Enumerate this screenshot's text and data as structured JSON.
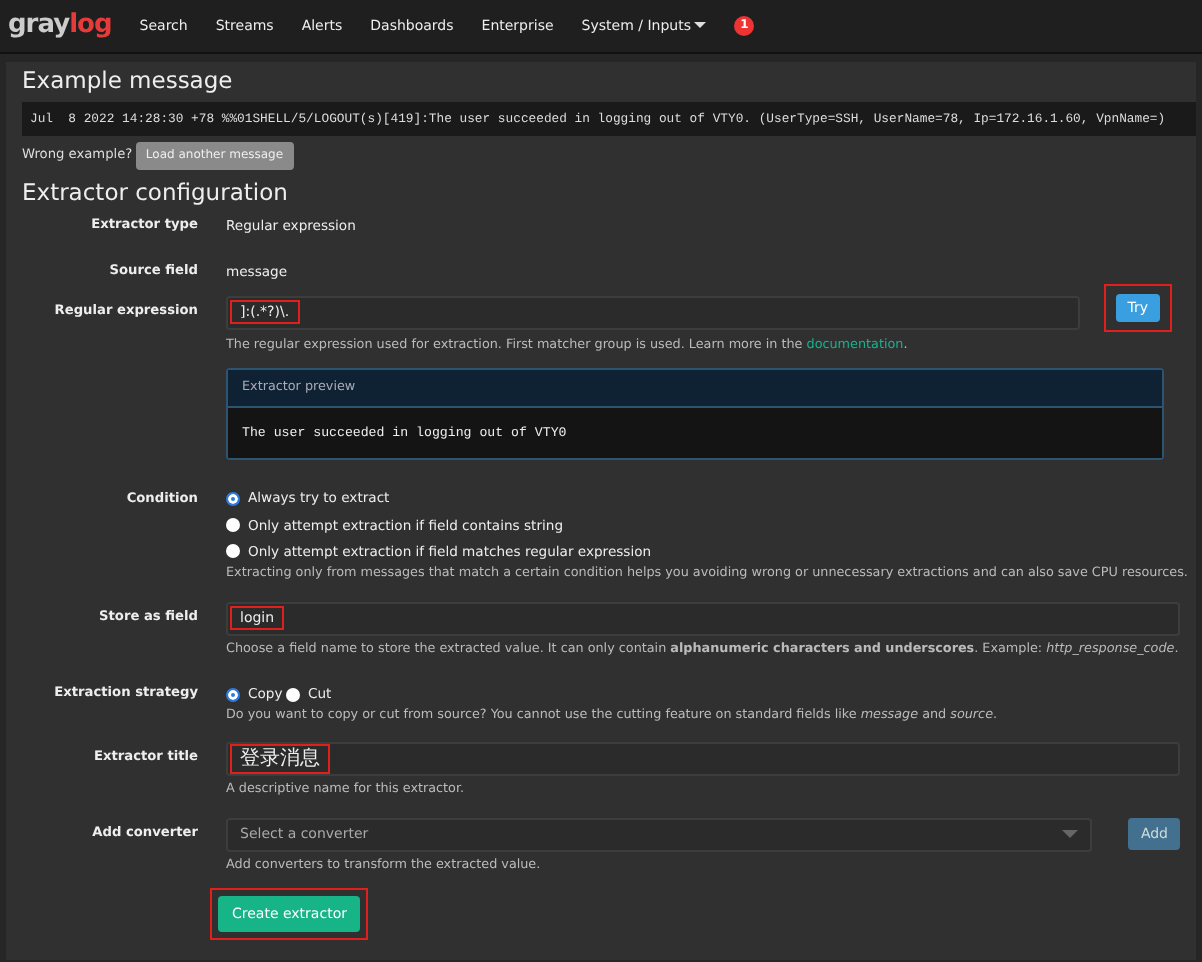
{
  "navbar": {
    "logo": "graylog",
    "items": [
      {
        "label": "Search",
        "dropdown": false
      },
      {
        "label": "Streams",
        "dropdown": false
      },
      {
        "label": "Alerts",
        "dropdown": false
      },
      {
        "label": "Dashboards",
        "dropdown": false
      },
      {
        "label": "Enterprise",
        "dropdown": false
      },
      {
        "label": "System / Inputs",
        "dropdown": true
      }
    ],
    "notification_count": "1"
  },
  "example": {
    "title": "Example message",
    "message": "Jul  8 2022 14:28:30 +78 %%01SHELL/5/LOGOUT(s)[419]:The user succeeded in logging out of VTY0. (UserType=SSH, UserName=78, Ip=172.16.1.60, VpnName=)",
    "wrong_label": "Wrong example?",
    "load_button": "Load another message"
  },
  "config": {
    "title": "Extractor configuration",
    "extractor_type": {
      "label": "Extractor type",
      "value": "Regular expression"
    },
    "source_field": {
      "label": "Source field",
      "value": "message"
    },
    "regex": {
      "label": "Regular expression",
      "value": "]:(.*?)\\.",
      "highlighted": true,
      "help": "The regular expression used for extraction. First matcher group is used. Learn more in the",
      "help_link": "documentation",
      "help_end": ".",
      "try_button": "Try",
      "try_highlighted": true
    },
    "preview": {
      "title": "Extractor preview",
      "value": "The user succeeded in logging out of VTY0"
    },
    "condition": {
      "label": "Condition",
      "options": [
        {
          "label": "Always try to extract",
          "selected": true
        },
        {
          "label": "Only attempt extraction if field contains string",
          "selected": false
        },
        {
          "label": "Only attempt extraction if field matches regular expression",
          "selected": false
        }
      ],
      "help": "Extracting only from messages that match a certain condition helps you avoiding wrong or unnecessary extractions and can also save CPU resources."
    },
    "store_as": {
      "label": "Store as field",
      "value": "login",
      "highlighted": true,
      "help": "Choose a field name to store the extracted value. It can only contain **alphanumeric characters and underscores**. Example: *http_response_code*."
    },
    "strategy": {
      "label": "Extraction strategy",
      "options": [
        {
          "label": "Copy",
          "selected": true
        },
        {
          "label": "Cut",
          "selected": false
        }
      ],
      "help": "Do you want to copy or cut from source? You cannot use the cutting feature on standard fields like *message* and *source*."
    },
    "title_field": {
      "label": "Extractor title",
      "value": "登录消息",
      "highlighted": true,
      "help": "A descriptive name for this extractor."
    },
    "converter": {
      "label": "Add converter",
      "placeholder": "Select a converter",
      "add_button": "Add",
      "help": "Add converters to transform the extracted value."
    },
    "create_button": {
      "label": "Create extractor",
      "highlighted": true
    }
  }
}
